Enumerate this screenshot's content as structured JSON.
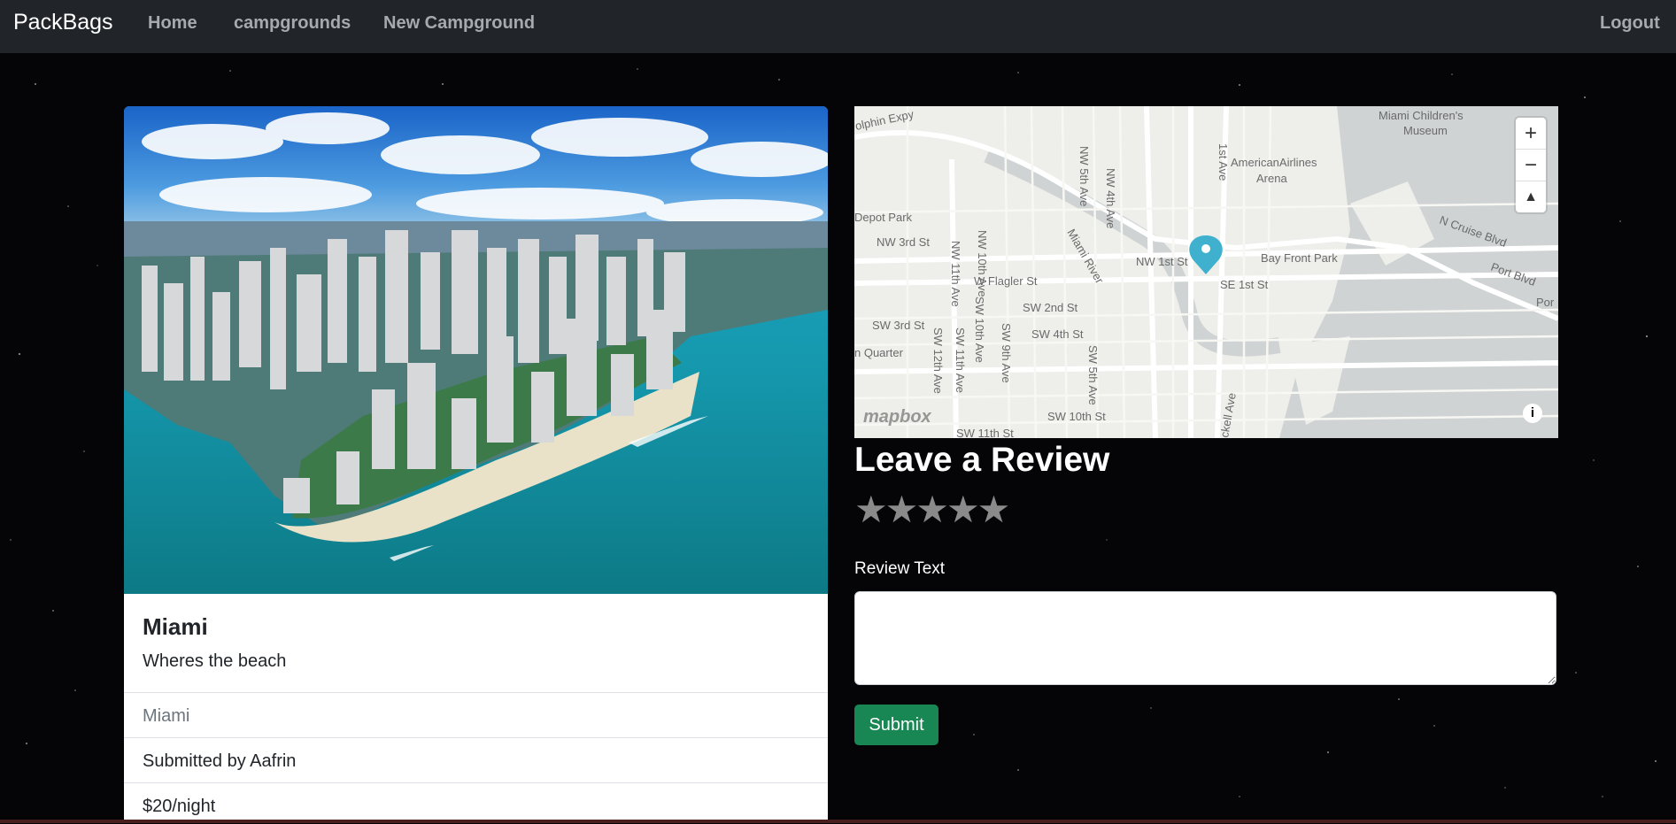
{
  "navbar": {
    "brand": "PackBags",
    "links": [
      "Home",
      "campgrounds",
      "New Campground"
    ],
    "logout": "Logout",
    "bg_color": "#212529"
  },
  "campground": {
    "image_alt": "Aerial view of Miami skyline and island",
    "title": "Miami",
    "description": "Wheres the beach",
    "location": "Miami",
    "submitted_by": "Submitted by Aafrin",
    "price": "$20/night"
  },
  "map": {
    "street_labels": [
      "olphin Expy",
      "Miami Children's",
      "Museum",
      "1st Ave",
      "NW 5th Ave",
      "NW 4th Ave",
      "AmericanAirlines",
      "Arena",
      "Depot Park",
      "NW 3rd St",
      "NW 11th Ave",
      "NW 10th Ave",
      "Miami River",
      "NW 1st St",
      "Bay Front Park",
      "N Cruise Blvd",
      "Port Blvd",
      "W Flagler St",
      "SE 1st St",
      "SW 3rd St",
      "SW 2nd St",
      "SW 4th St",
      "SW 10th Ave",
      "SW 11th Ave",
      "SW 9th Ave",
      "SW 5th Ave",
      "n Quarter",
      "SW 12th Ave",
      "ckell Ave",
      "SW 10th St",
      "SW 11th St",
      "Por"
    ],
    "zoom_in": "+",
    "zoom_out": "−",
    "compass": "▲",
    "info": "i",
    "logo": "mapbox",
    "marker_color": "#3fb1ce"
  },
  "review": {
    "heading": "Leave a Review",
    "rating_icons": "★★★★★",
    "label": "Review Text",
    "text_value": "",
    "submit": "Submit"
  }
}
